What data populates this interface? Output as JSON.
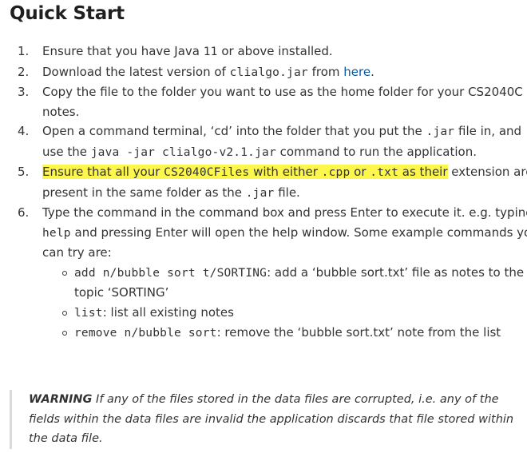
{
  "doc": {
    "title": "Quick Start",
    "steps": [
      {
        "text_before": "Ensure that you have Java ",
        "code": "11",
        "text_after": " or above installed."
      },
      {
        "text_before": "Download the latest version of ",
        "code": "clialgo.jar",
        "text_middle": " from ",
        "link_text": "here",
        "text_after": "."
      },
      {
        "text": "Copy the file to the folder you want to use as the home folder for your CS2040C notes."
      },
      {
        "text_before": "Open a command terminal, ‘cd’ into the folder that you put the ",
        "code1": ".jar",
        "text_middle": " file in, and use the ",
        "code2": "java -jar clialgo-v2.1.jar",
        "text_after": " command to run the application."
      },
      {
        "text_before": "Ensure that all your ",
        "code1": "CS2040CFiles",
        "text_middle1": " with either ",
        "code2": ".cpp",
        "text_middle2": " or ",
        "code3": ".txt",
        "text_middle3": " as their",
        "text_middle4": " extension are present in the same folder as the ",
        "code4": ".jar",
        "text_after": " file."
      },
      {
        "text_before": "Type the command in the command box and press Enter to execute it. e.g. typing ",
        "code": "help",
        "text_after": " and pressing Enter will open the help window. Some example commands you can try are:",
        "examples": [
          {
            "code": "add n/bubble sort t/SORTING",
            "text": ": add a ‘bubble sort.txt’ file as notes to the topic ‘SORTING’"
          },
          {
            "code": "list",
            "text": ": list all existing notes"
          },
          {
            "code": "remove n/bubble sort",
            "text": ": remove the ‘bubble sort.txt’ note from the list"
          }
        ]
      }
    ],
    "warning": {
      "label": "WARNING",
      "text": " If any of the files stored in the data files are corrupted, i.e. any of the fields within the data files are invalid the application discards that file stored within the data file."
    }
  },
  "colors": {
    "highlight": "#fdf64d",
    "link": "#0b5aa2",
    "text": "#333333",
    "quote_border": "#d9d9d9"
  }
}
